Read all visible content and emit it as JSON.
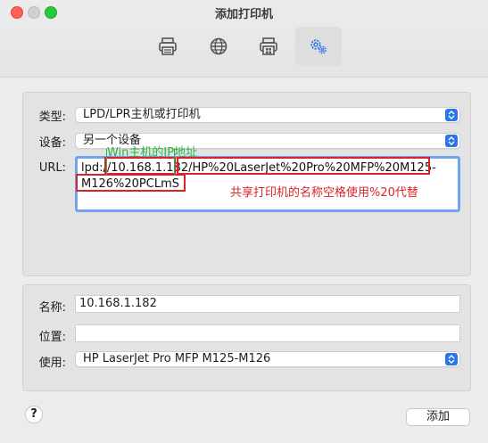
{
  "window": {
    "title": "添加打印机"
  },
  "toolbar": {
    "buttons": [
      {
        "icon": "printer-icon"
      },
      {
        "icon": "globe-icon"
      },
      {
        "icon": "printer-window-icon"
      },
      {
        "icon": "gears-icon"
      }
    ],
    "active_index": 3
  },
  "form": {
    "type_label": "类型:",
    "type_value": "LPD/LPR主机或打印机",
    "device_label": "设备:",
    "device_value": "另一个设备",
    "url_label": "URL:",
    "url_value": "lpd://10.168.1.182/HP%20LaserJet%20Pro%20MFP%20M125-M126%20PCLmS",
    "name_label": "名称:",
    "name_value": "10.168.1.182",
    "location_label": "位置:",
    "location_value": "",
    "use_label": "使用:",
    "use_value": "HP LaserJet Pro MFP M125-M126"
  },
  "annotations": {
    "ip_note": "Win主机的IP地址",
    "share_note": "共享打印机的名称空格使用%20代替"
  },
  "footer": {
    "help_label": "?",
    "add_label": "添加"
  },
  "colors": {
    "accent": "#2a76e8",
    "focus_ring": "#6fa4f2",
    "annotation_red": "#d8232a",
    "annotation_green": "#27b446"
  }
}
